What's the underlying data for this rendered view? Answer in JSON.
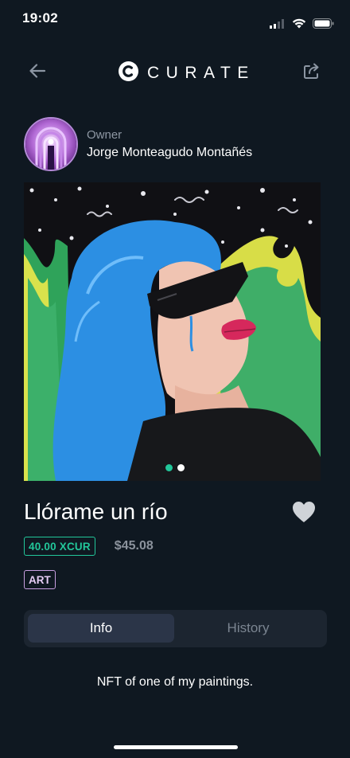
{
  "status_bar": {
    "time": "19:02"
  },
  "nav": {
    "brand": "CURATE"
  },
  "owner": {
    "label": "Owner",
    "name": "Jorge Monteagudo Montañés"
  },
  "artwork": {
    "carousel_active_index": 0,
    "carousel_count": 2,
    "colors": {
      "active_dot": "#22c79a",
      "inactive_dot": "#ffffff"
    }
  },
  "item": {
    "title": "Llórame un río",
    "price_token": "40.00 XCUR",
    "price_usd": "$45.08",
    "category": "ART",
    "description": "NFT of one of my paintings."
  },
  "tabs": [
    {
      "label": "Info",
      "active": true
    },
    {
      "label": "History",
      "active": false
    }
  ],
  "colors": {
    "background": "#0f1821",
    "accent_green": "#22c79a",
    "tag_purple": "#c9a0e2",
    "tab_active": "#2b3548",
    "tab_bar": "#1c2530"
  }
}
